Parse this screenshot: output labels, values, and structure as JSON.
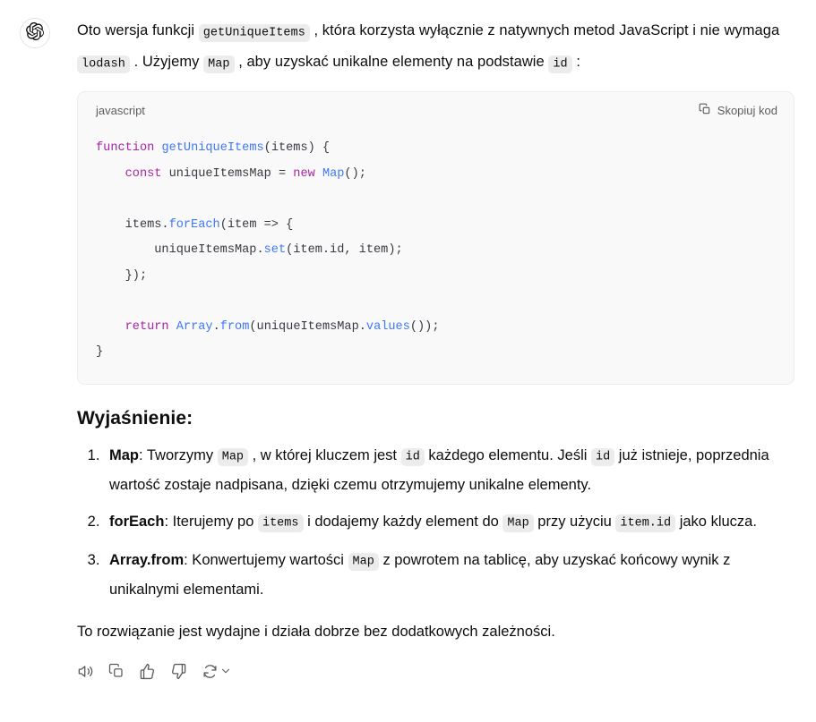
{
  "avatar": {
    "icon": "chatgpt-logo-icon"
  },
  "intro": {
    "segments": [
      {
        "type": "text",
        "value": "Oto wersja funkcji "
      },
      {
        "type": "code",
        "value": "getUniqueItems"
      },
      {
        "type": "text",
        "value": ", która korzysta wyłącznie z natywnych metod JavaScript i nie wymaga "
      },
      {
        "type": "code",
        "value": "lodash"
      },
      {
        "type": "text",
        "value": ". Użyjemy "
      },
      {
        "type": "code",
        "value": "Map"
      },
      {
        "type": "text",
        "value": ", aby uzyskać unikalne elementy na podstawie "
      },
      {
        "type": "code",
        "value": "id"
      },
      {
        "type": "text",
        "value": ":"
      }
    ]
  },
  "codeblock": {
    "language": "javascript",
    "copy_label": "Skopiuj kod",
    "copy_icon": "copy-icon",
    "lines": [
      [
        {
          "t": "kw",
          "v": "function"
        },
        {
          "t": "pl",
          "v": " "
        },
        {
          "t": "fn",
          "v": "getUniqueItems"
        },
        {
          "t": "pl",
          "v": "(items) {"
        }
      ],
      [
        {
          "t": "pl",
          "v": "    "
        },
        {
          "t": "kw",
          "v": "const"
        },
        {
          "t": "pl",
          "v": " uniqueItemsMap = "
        },
        {
          "t": "kw",
          "v": "new"
        },
        {
          "t": "pl",
          "v": " "
        },
        {
          "t": "cls",
          "v": "Map"
        },
        {
          "t": "pl",
          "v": "();"
        }
      ],
      [
        {
          "t": "pl",
          "v": ""
        }
      ],
      [
        {
          "t": "pl",
          "v": "    items."
        },
        {
          "t": "fn",
          "v": "forEach"
        },
        {
          "t": "pl",
          "v": "(item => {"
        }
      ],
      [
        {
          "t": "pl",
          "v": "        uniqueItemsMap."
        },
        {
          "t": "fn",
          "v": "set"
        },
        {
          "t": "pl",
          "v": "(item.id, item);"
        }
      ],
      [
        {
          "t": "pl",
          "v": "    });"
        }
      ],
      [
        {
          "t": "pl",
          "v": ""
        }
      ],
      [
        {
          "t": "pl",
          "v": "    "
        },
        {
          "t": "kw",
          "v": "return"
        },
        {
          "t": "pl",
          "v": " "
        },
        {
          "t": "cls",
          "v": "Array"
        },
        {
          "t": "pl",
          "v": "."
        },
        {
          "t": "fn",
          "v": "from"
        },
        {
          "t": "pl",
          "v": "(uniqueItemsMap."
        },
        {
          "t": "fn",
          "v": "values"
        },
        {
          "t": "pl",
          "v": "());"
        }
      ],
      [
        {
          "t": "pl",
          "v": "}"
        }
      ]
    ]
  },
  "explanation": {
    "title": "Wyjaśnienie:",
    "items": [
      {
        "segments": [
          {
            "type": "term",
            "value": "Map"
          },
          {
            "type": "text",
            "value": ": Tworzymy "
          },
          {
            "type": "code",
            "value": "Map"
          },
          {
            "type": "text",
            "value": ", w której kluczem jest "
          },
          {
            "type": "code",
            "value": "id"
          },
          {
            "type": "text",
            "value": " każdego elementu. Jeśli "
          },
          {
            "type": "code",
            "value": "id"
          },
          {
            "type": "text",
            "value": " już istnieje, poprzednia wartość zostaje nadpisana, dzięki czemu otrzymujemy unikalne elementy."
          }
        ]
      },
      {
        "segments": [
          {
            "type": "term",
            "value": "forEach"
          },
          {
            "type": "text",
            "value": ": Iterujemy po "
          },
          {
            "type": "code",
            "value": "items"
          },
          {
            "type": "text",
            "value": " i dodajemy każdy element do "
          },
          {
            "type": "code",
            "value": "Map"
          },
          {
            "type": "text",
            "value": " przy użyciu "
          },
          {
            "type": "code",
            "value": "item.id"
          },
          {
            "type": "text",
            "value": " jako klucza."
          }
        ]
      },
      {
        "segments": [
          {
            "type": "term",
            "value": "Array.from"
          },
          {
            "type": "text",
            "value": ": Konwertujemy wartości "
          },
          {
            "type": "code",
            "value": "Map"
          },
          {
            "type": "text",
            "value": " z powrotem na tablicę, aby uzyskać końcowy wynik z unikalnymi elementami."
          }
        ]
      }
    ]
  },
  "closing": "To rozwiązanie jest wydajne i działa dobrze bez dodatkowych zależności.",
  "actions": [
    {
      "name": "read-aloud-button",
      "icon": "speaker-icon"
    },
    {
      "name": "copy-button",
      "icon": "copy-icon"
    },
    {
      "name": "thumbs-up-button",
      "icon": "thumbs-up-icon"
    },
    {
      "name": "thumbs-down-button",
      "icon": "thumbs-down-icon"
    },
    {
      "name": "regenerate-button",
      "icon": "regenerate-icon"
    }
  ],
  "colors": {
    "keyword": "#a626a4",
    "function": "#4078f2",
    "chip_bg": "#ececec",
    "code_bg": "#f9f9f9",
    "text": "#0d0d0d",
    "muted": "#5d5d5d"
  }
}
